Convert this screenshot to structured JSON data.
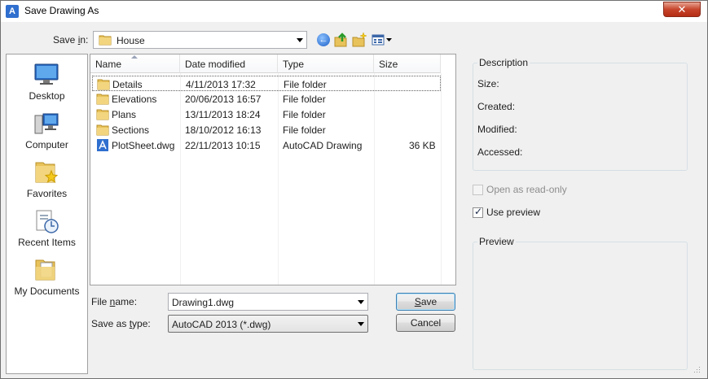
{
  "window": {
    "title": "Save Drawing As",
    "close_glyph": "✕"
  },
  "save_in": {
    "label_pre": "Save ",
    "label_accel": "i",
    "label_post": "n:",
    "folder": "House"
  },
  "toolbar": {
    "back_icon": "back-arrow-icon",
    "up_icon": "up-folder-icon",
    "new_folder_icon": "new-folder-icon",
    "views_icon": "views-menu-icon"
  },
  "places": [
    {
      "label": "Desktop",
      "icon": "desktop-icon"
    },
    {
      "label": "Computer",
      "icon": "computer-icon"
    },
    {
      "label": "Favorites",
      "icon": "favorites-icon"
    },
    {
      "label": "Recent Items",
      "icon": "recent-items-icon"
    },
    {
      "label": "My Documents",
      "icon": "my-documents-icon"
    }
  ],
  "columns": [
    "Name",
    "Date modified",
    "Type",
    "Size"
  ],
  "files": [
    {
      "name": "Details",
      "date": "4/11/2013 17:32",
      "type": "File folder",
      "size": "",
      "icon": "folder-icon"
    },
    {
      "name": "Elevations",
      "date": "20/06/2013 16:57",
      "type": "File folder",
      "size": "",
      "icon": "folder-icon"
    },
    {
      "name": "Plans",
      "date": "13/11/2013 18:24",
      "type": "File folder",
      "size": "",
      "icon": "folder-icon"
    },
    {
      "name": "Sections",
      "date": "18/10/2012 16:13",
      "type": "File folder",
      "size": "",
      "icon": "folder-icon"
    },
    {
      "name": "PlotSheet.dwg",
      "date": "22/11/2013 10:15",
      "type": "AutoCAD Drawing",
      "size": "36 KB",
      "icon": "dwg-file-icon"
    }
  ],
  "file_name": {
    "label_pre": "File ",
    "label_accel": "n",
    "label_post": "ame:",
    "value": "Drawing1.dwg"
  },
  "save_as_type": {
    "label_pre": "Save as ",
    "label_accel": "t",
    "label_post": "ype:",
    "value": "AutoCAD 2013 (*.dwg)"
  },
  "buttons": {
    "save_accel": "S",
    "save_rest": "ave",
    "cancel": "Cancel"
  },
  "description": {
    "title": "Description",
    "size_label": "Size:",
    "created_label": "Created:",
    "modified_label": "Modified:",
    "accessed_label": "Accessed:"
  },
  "options": {
    "open_read_only": {
      "label": "Open as read-only",
      "checked": false,
      "enabled": false
    },
    "use_preview": {
      "label": "Use preview",
      "checked": true,
      "enabled": true,
      "check_glyph": "✓"
    }
  },
  "preview": {
    "title": "Preview"
  },
  "colors": {
    "folder": "#e8c25a",
    "accent": "#2f6fcf",
    "close": "#c7452c"
  }
}
